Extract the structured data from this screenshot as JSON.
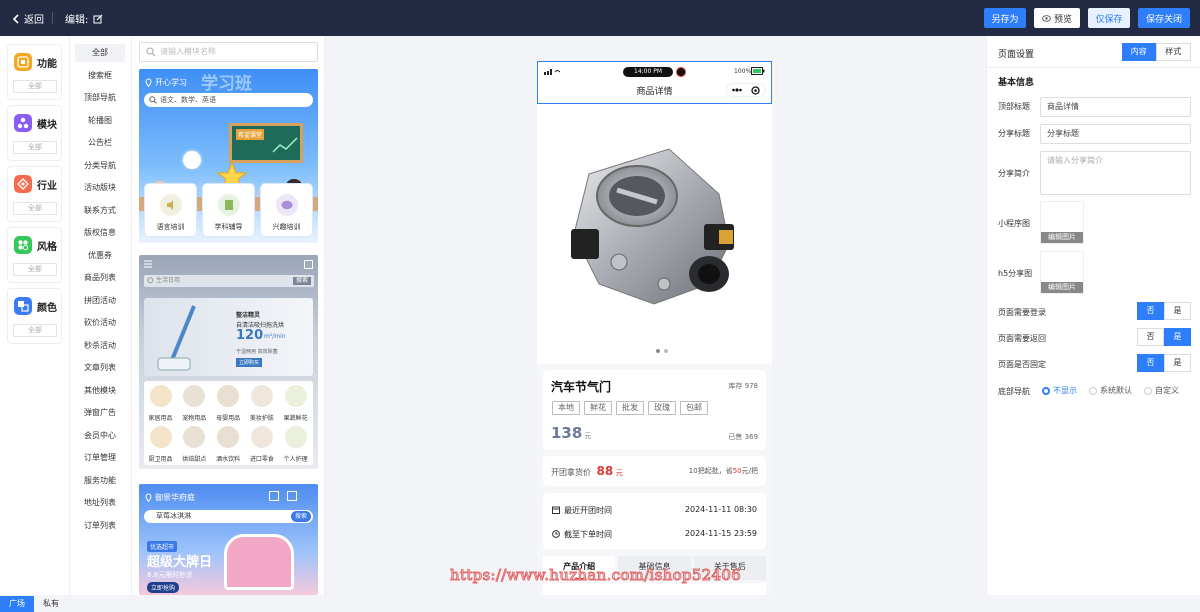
{
  "topbar": {
    "back_label": "返回",
    "edit_label": "编辑:",
    "save_as": "另存为",
    "preview": "预览",
    "save_only": "仅保存",
    "save_close": "保存关闭"
  },
  "categories": [
    {
      "label": "功能",
      "all": "全部",
      "color": "#f5a623"
    },
    {
      "label": "模块",
      "all": "全部",
      "color": "#8b5cf6"
    },
    {
      "label": "行业",
      "all": "全部",
      "color": "#f26c4f"
    },
    {
      "label": "风格",
      "all": "全部",
      "color": "#34c759"
    },
    {
      "label": "颜色",
      "all": "全部",
      "color": "#3b7cf5"
    }
  ],
  "bottom_tabs": {
    "plaza": "广场",
    "private": "私有"
  },
  "sub_items": [
    "全部",
    "搜索框",
    "顶部导航",
    "轮播图",
    "公告栏",
    "分类导航",
    "活动版块",
    "联系方式",
    "版权信息",
    "优惠券",
    "商品列表",
    "拼团活动",
    "砍价活动",
    "秒杀活动",
    "文章列表",
    "其他模块",
    "弹窗广告",
    "会员中心",
    "订单管理",
    "服务功能",
    "地址列表",
    "订单列表"
  ],
  "templates": {
    "search_placeholder": "请输入模块名称",
    "card1": {
      "brand": "开心学习",
      "headline": "学习班",
      "search_hint": "语文、数学、英语",
      "board": "希望课堂",
      "icons": [
        "语言培训",
        "学科辅导",
        "兴趣培训"
      ]
    },
    "card2": {
      "search_hint": "生活日用",
      "search_btn": "搜索",
      "banner_title": "整洁精灵",
      "banner_sub": "自清洁吸扫拖洗烘",
      "banner_num": "120",
      "banner_unit": "m²/min",
      "banner_desc": "干湿两用 高效除菌",
      "banner_btn": "立即购买",
      "row1": [
        "家居用品",
        "宠物用品",
        "母婴用品",
        "美妆护肤",
        "果蔬鲜花"
      ],
      "row2": [
        "厨卫用品",
        "烘焙甜点",
        "酒水饮料",
        "进口零食",
        "个人护理"
      ]
    },
    "card3": {
      "location": "御景华府庭",
      "search_hint": "草莓冰淇淋",
      "search_btn": "搜索",
      "badge": "优选超市",
      "headline": "超级大牌日",
      "sub": "8.8元限时秒杀",
      "cta": "立即抢购"
    }
  },
  "phone": {
    "time": "14:00 PM",
    "battery": "100%",
    "page_title": "商品详情",
    "product_name": "汽车节气门",
    "stock": "库存 978",
    "tags": [
      "本地",
      "鲜花",
      "批发",
      "玫瑰",
      "包邮"
    ],
    "price": "138",
    "price_unit": "元",
    "sold": "已售 369",
    "group_label": "开团拿货价",
    "group_price": "88",
    "group_unit": "元",
    "group_rule_pre": "10把起批，省",
    "group_save": "50",
    "group_rule_post": "元/把",
    "open_label": "最近开团时间",
    "open_time": "2024-11-11 08:30",
    "close_label": "截至下单时间",
    "close_time": "2024-11-15 23:59",
    "tabs": [
      "产品介绍",
      "基础信息",
      "关于售后"
    ]
  },
  "props": {
    "title": "页面设置",
    "tab_content": "内容",
    "tab_style": "样式",
    "section": "基本信息",
    "top_title_label": "顶部标题",
    "top_title_value": "商品详情",
    "share_title_label": "分享标题",
    "share_title_value": "分享标题",
    "share_desc_label": "分享简介",
    "share_desc_placeholder": "请输入分享简介",
    "mini_img_label": "小程序图",
    "h5_img_label": "h5分享图",
    "edit_img": "编辑图片",
    "need_login_label": "页面需要登录",
    "need_back_label": "页面需要返回",
    "fixed_label": "页面是否固定",
    "no": "否",
    "yes": "是",
    "bottom_nav_label": "底部导航",
    "nav_options": [
      "不显示",
      "系统默认",
      "自定义"
    ]
  },
  "watermark": "https://www.huzhan.com/ishop52406",
  "colors": {
    "accent": "#2d7ef8",
    "topbar": "#222b43",
    "price_red": "#e53935"
  }
}
